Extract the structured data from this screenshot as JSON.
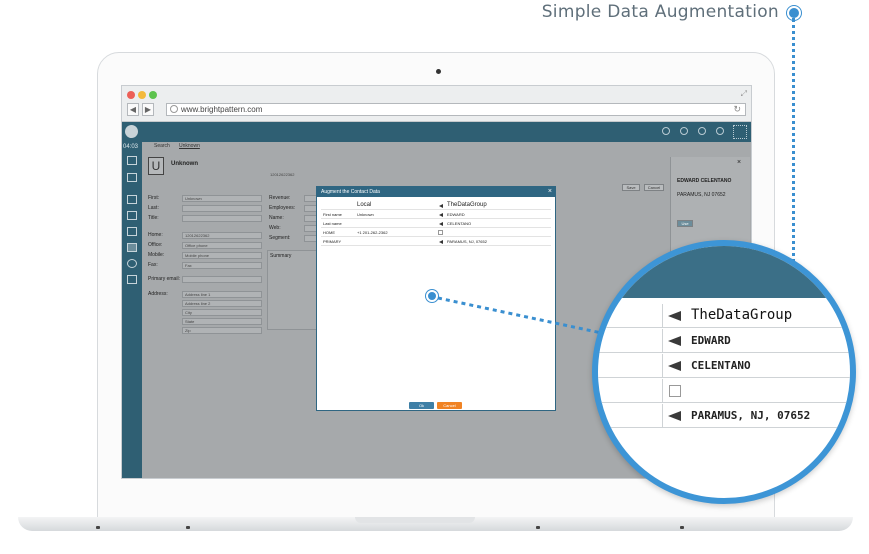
{
  "headline": "Simple Data Augmentation",
  "browser": {
    "url": "www.brightpattern.com"
  },
  "app": {
    "clock": "04:03",
    "tabs": [
      "Search",
      "Unknown"
    ],
    "contact_initial": "U",
    "contact_name": "Unknown",
    "phone_header": "12012622362",
    "form_left": [
      {
        "label": "First:",
        "value": "Unknown"
      },
      {
        "label": "Last:",
        "value": ""
      },
      {
        "label": "Title:",
        "value": ""
      },
      {
        "label": "Home:",
        "value": "12012622362"
      },
      {
        "label": "Office:",
        "value": "Office phone"
      },
      {
        "label": "Mobile:",
        "value": "Mobile phone"
      },
      {
        "label": "Fax:",
        "value": "Fax"
      },
      {
        "label": "Primary email:",
        "value": ""
      },
      {
        "label": "Address:",
        "value": "Address line 1"
      }
    ],
    "address_lines": [
      "Address line 2",
      "City",
      "State",
      "Zip"
    ],
    "form_right_labels": [
      "Revenue:",
      "Employees:",
      "Name:",
      "Web:",
      "Segment:"
    ],
    "summary_label": "Summary",
    "save": "Save",
    "cancel": "Cancel",
    "right_panel": {
      "name": "EDWARD CELENTANO",
      "address": "PARAMUS, NJ 07652",
      "button": "Use"
    }
  },
  "dialog": {
    "title": "Augment the Contact Data",
    "col_local": "Local",
    "col_remote": "TheDataGroup",
    "rows": [
      {
        "field": "First name",
        "local": "Unknown",
        "remote": "EDWARD",
        "arrow": true
      },
      {
        "field": "Last name",
        "local": "",
        "remote": "CELENTANO",
        "arrow": true
      },
      {
        "field": "HOME",
        "local": "+1 201-262-2362",
        "remote": "",
        "arrow": false
      },
      {
        "field": "PRIMARY",
        "local": "",
        "remote": "PARAMUS, NJ, 07652",
        "arrow": true
      }
    ],
    "ok": "Ok",
    "cancel": "Cancel"
  },
  "magnifier": {
    "rows": [
      {
        "text": "TheDataGroup",
        "arrow": true
      },
      {
        "text": "EDWARD",
        "arrow": true
      },
      {
        "text": "CELENTANO",
        "arrow": true
      },
      {
        "text": "",
        "arrow": false
      },
      {
        "text": "PARAMUS, NJ, 07652",
        "arrow": true
      }
    ]
  },
  "colors": {
    "accent_blue": "#3a8fd0",
    "app_teal": "#2f5f73",
    "dialog_header": "#2f6682",
    "cancel_orange": "#f08324"
  }
}
